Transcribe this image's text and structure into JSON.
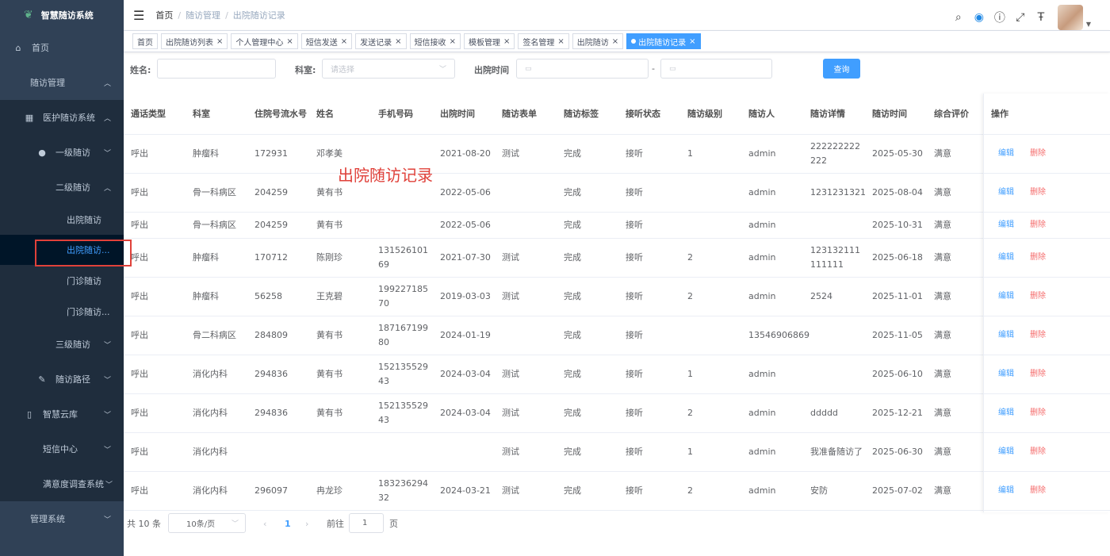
{
  "app_title": "智慧随访系统",
  "sidebar": {
    "items": [
      {
        "label": "首页",
        "icon": "dashboard-icon"
      },
      {
        "label": "随访管理",
        "chevron": "up"
      },
      {
        "label": "医护随访系统",
        "icon": "grid-icon",
        "chevron": "up"
      },
      {
        "label": "一级随访",
        "icon": "user-icon",
        "chevron": "down"
      },
      {
        "label": "二级随访",
        "chevron": "up"
      },
      {
        "label": "出院随访"
      },
      {
        "label": "出院随访..."
      },
      {
        "label": "门诊随访"
      },
      {
        "label": "门诊随访..."
      },
      {
        "label": "三级随访",
        "chevron": "down"
      },
      {
        "label": "随访路径",
        "icon": "edit-icon",
        "chevron": "down"
      },
      {
        "label": "智慧云库",
        "icon": "book-icon",
        "chevron": "down"
      },
      {
        "label": "短信中心",
        "chevron": "down"
      },
      {
        "label": "满意度调查系统",
        "chevron": "down"
      },
      {
        "label": "管理系统",
        "chevron": "down"
      }
    ]
  },
  "breadcrumb": [
    "首页",
    "随访管理",
    "出院随访记录"
  ],
  "tags": [
    {
      "label": "首页",
      "closable": false
    },
    {
      "label": "出院随访列表",
      "closable": true
    },
    {
      "label": "个人管理中心",
      "closable": true
    },
    {
      "label": "短信发送",
      "closable": true
    },
    {
      "label": "发送记录",
      "closable": true
    },
    {
      "label": "短信接收",
      "closable": true
    },
    {
      "label": "模板管理",
      "closable": true
    },
    {
      "label": "签名管理",
      "closable": true
    },
    {
      "label": "出院随访",
      "closable": true
    },
    {
      "label": "出院随访记录",
      "closable": true,
      "active": true
    }
  ],
  "filters": {
    "name_label": "姓名:",
    "name_value": "",
    "dept_label": "科室:",
    "dept_placeholder": "请选择",
    "discharge_label": "出院时间",
    "range_sep": "-",
    "query_button": "查询"
  },
  "table": {
    "headers": [
      "通话类型",
      "科室",
      "住院号流水号",
      "姓名",
      "手机号码",
      "出院时间",
      "随访表单",
      "随访标签",
      "接听状态",
      "随访级别",
      "随访人",
      "随访详情",
      "随访时间",
      "综合评价",
      "操作"
    ],
    "edit_label": "编辑",
    "delete_label": "删除",
    "rows": [
      [
        "呼出",
        "肿瘤科",
        "172931",
        "邓孝美",
        "",
        "2021-08-20",
        "测试",
        "完成",
        "接听",
        "1",
        "admin",
        "222222222222",
        "2025-05-30",
        "满意"
      ],
      [
        "呼出",
        "骨一科病区",
        "204259",
        "黄有书",
        "",
        "2022-05-06",
        "",
        "完成",
        "接听",
        "",
        "admin",
        "1231231321",
        "2025-08-04",
        "满意"
      ],
      [
        "呼出",
        "骨一科病区",
        "204259",
        "黄有书",
        "",
        "2022-05-06",
        "",
        "完成",
        "接听",
        "",
        "admin",
        "",
        "2025-10-31",
        "满意"
      ],
      [
        "呼出",
        "肿瘤科",
        "170712",
        "陈刚珍",
        "13152610169",
        "2021-07-30",
        "测试",
        "完成",
        "接听",
        "2",
        "admin",
        "123132111111111",
        "2025-06-18",
        "满意"
      ],
      [
        "呼出",
        "肿瘤科",
        "56258",
        "王克碧",
        "19922718570",
        "2019-03-03",
        "测试",
        "完成",
        "接听",
        "2",
        "admin",
        "2524",
        "2025-11-01",
        "满意"
      ],
      [
        "呼出",
        "骨二科病区",
        "284809",
        "黄有书",
        "18716719980",
        "2024-01-19",
        "",
        "完成",
        "接听",
        "",
        "13546906869",
        "",
        "2025-11-05",
        "满意"
      ],
      [
        "呼出",
        "消化内科",
        "294836",
        "黄有书",
        "15213552943",
        "2024-03-04",
        "测试",
        "完成",
        "接听",
        "1",
        "admin",
        "",
        "2025-06-10",
        "满意"
      ],
      [
        "呼出",
        "消化内科",
        "294836",
        "黄有书",
        "15213552943",
        "2024-03-04",
        "测试",
        "完成",
        "接听",
        "2",
        "admin",
        "ddddd",
        "2025-12-21",
        "满意"
      ],
      [
        "呼出",
        "消化内科",
        "",
        "",
        "",
        "",
        "测试",
        "完成",
        "接听",
        "1",
        "admin",
        "我准备随访了",
        "2025-06-30",
        "满意"
      ],
      [
        "呼出",
        "消化内科",
        "296097",
        "冉龙珍",
        "18323629432",
        "2024-03-21",
        "测试",
        "完成",
        "接听",
        "2",
        "admin",
        "安防",
        "2025-07-02",
        "满意"
      ]
    ]
  },
  "annotation": "出院随访记录",
  "pagination": {
    "total": "共 10 条",
    "page_size": "10条/页",
    "prev": "‹",
    "current": "1",
    "next": "›",
    "goto_label": "前往",
    "goto_value": "1",
    "page_unit": "页"
  },
  "colors": {
    "sidebar_bg": "#304156",
    "accent": "#409eff",
    "danger": "#f56c6c",
    "highlight_box": "#e0413a"
  }
}
